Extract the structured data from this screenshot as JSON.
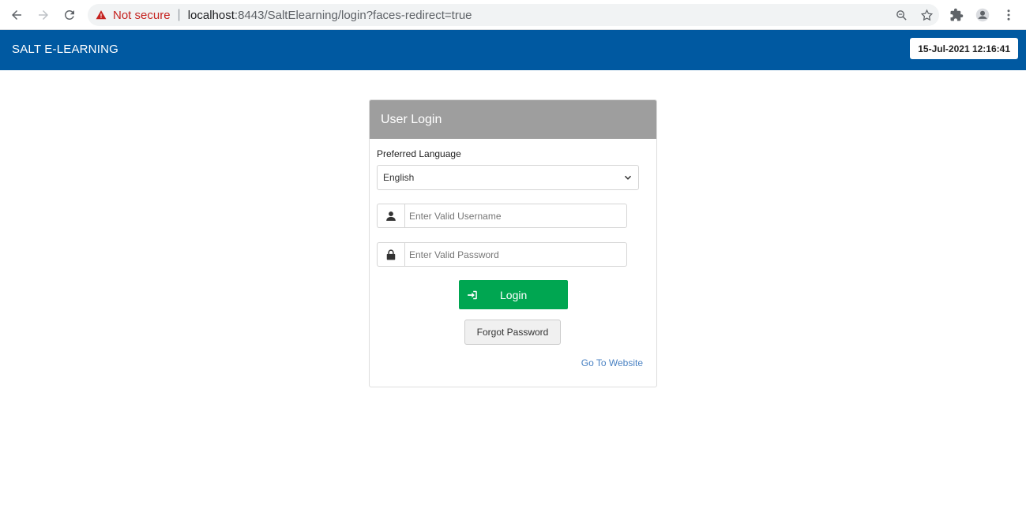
{
  "browser": {
    "security_label": "Not secure",
    "url_host": "localhost",
    "url_rest": ":8443/SaltElearning/login?faces-redirect=true",
    "icons": [
      "back-icon",
      "forward-icon",
      "reload-icon",
      "warning-icon",
      "zoom-icon",
      "star-icon",
      "extensions-icon",
      "profile-icon",
      "more-icon"
    ]
  },
  "header": {
    "title": "SALT E-LEARNING",
    "datetime": "15-Jul-2021 12:16:41",
    "color": "#0059a1"
  },
  "login": {
    "title": "User Login",
    "language_label": "Preferred Language",
    "language_selected": "English",
    "username_placeholder": "Enter Valid Username",
    "password_placeholder": "Enter Valid Password",
    "login_label": "Login",
    "forgot_label": "Forgot Password",
    "website_link": "Go To Website",
    "login_color": "#00a651"
  }
}
